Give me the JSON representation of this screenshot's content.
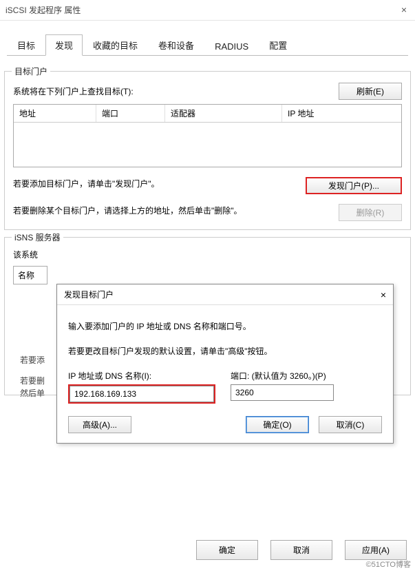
{
  "window": {
    "title": "iSCSI 发起程序 属性",
    "close": "×"
  },
  "tabs": {
    "target": "目标",
    "discover": "发现",
    "favorites": "收藏的目标",
    "volumes": "卷和设备",
    "radius": "RADIUS",
    "config": "配置"
  },
  "target_portal": {
    "group_title": "目标门户",
    "find_text": "系统将在下列门户上查找目标(T):",
    "refresh_btn": "刷新(E)",
    "columns": {
      "address": "地址",
      "port": "端口",
      "adapter": "适配器",
      "ip": "IP 地址"
    },
    "add_desc": "若要添加目标门户，请单击\"发现门户\"。",
    "discover_btn": "发现门户(P)...",
    "delete_desc": "若要删除某个目标门户，请选择上方的地址，然后单击\"删除\"。",
    "delete_btn": "删除(R)"
  },
  "isns": {
    "group_title": "iSNS 服务器",
    "registered_text": "该系统",
    "name_label": "名称",
    "add_desc_1": "若要添",
    "delete_desc_1": "若要删",
    "delete_desc_2": "然后单"
  },
  "dialog": {
    "title": "发现目标门户",
    "close": "×",
    "line1": "输入要添加门户的 IP 地址或 DNS 名称和端口号。",
    "line2": "若要更改目标门户发现的默认设置，请单击\"高级\"按钮。",
    "ip_label": "IP 地址或 DNS 名称(I):",
    "ip_value": "192.168.169.133",
    "port_label": "端口: (默认值为 3260。)(P)",
    "port_value": "3260",
    "advanced_btn": "高级(A)...",
    "ok_btn": "确定(O)",
    "cancel_btn": "取消(C)"
  },
  "footer": {
    "ok": "确定",
    "cancel": "取消",
    "apply": "应用(A)"
  },
  "watermark": "©51CTO博客"
}
